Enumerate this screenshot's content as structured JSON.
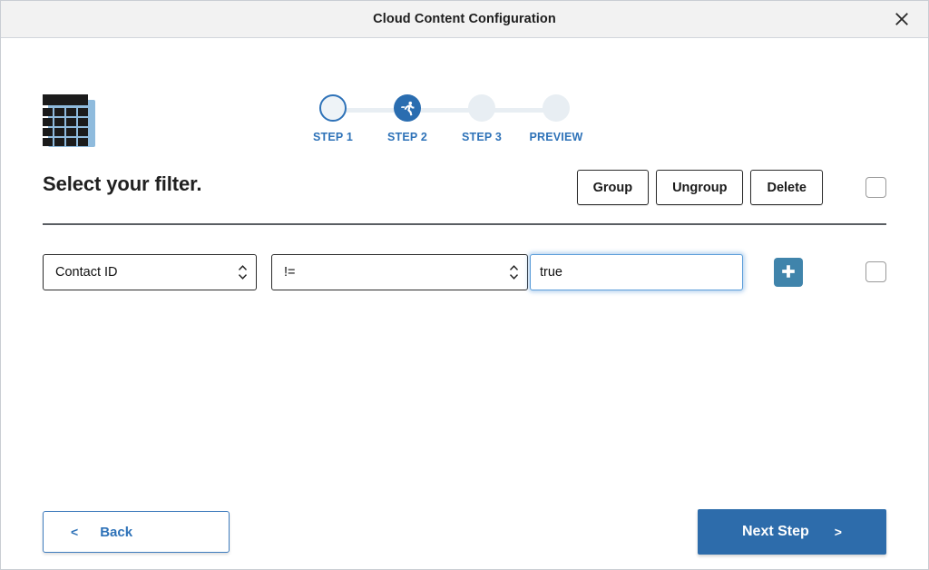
{
  "window": {
    "title": "Cloud Content Configuration",
    "close_icon": "close-icon"
  },
  "logo": {
    "icon": "table-grid-icon"
  },
  "stepper": {
    "steps": [
      {
        "label": "STEP 1",
        "state": "done",
        "icon": "empty-circle-icon"
      },
      {
        "label": "STEP 2",
        "state": "active",
        "icon": "runner-icon"
      },
      {
        "label": "STEP 3",
        "state": "todo",
        "icon": "empty-circle-icon"
      },
      {
        "label": "PREVIEW",
        "state": "todo",
        "icon": "empty-circle-icon"
      }
    ]
  },
  "heading": {
    "title": "Select your filter.",
    "buttons": [
      {
        "label": "Group"
      },
      {
        "label": "Ungroup"
      },
      {
        "label": "Delete"
      }
    ],
    "select_all_checked": false
  },
  "filter_row": {
    "field": {
      "value": "Contact ID",
      "options": [
        "Contact ID"
      ]
    },
    "operator": {
      "value": "!=",
      "options": [
        "!="
      ]
    },
    "value_input": {
      "value": "true",
      "placeholder": ""
    },
    "add_icon": "plus-icon",
    "row_checked": false
  },
  "footer": {
    "back_label": "Back",
    "back_chevron": "<",
    "next_label": "Next Step",
    "next_chevron": ">"
  },
  "colors": {
    "accent_blue": "#2d6cab",
    "step_blue": "#2e72b8",
    "add_button_blue": "#4084ab",
    "titlebar_bg": "#f2f2f2",
    "divider": "#5a5e63"
  }
}
